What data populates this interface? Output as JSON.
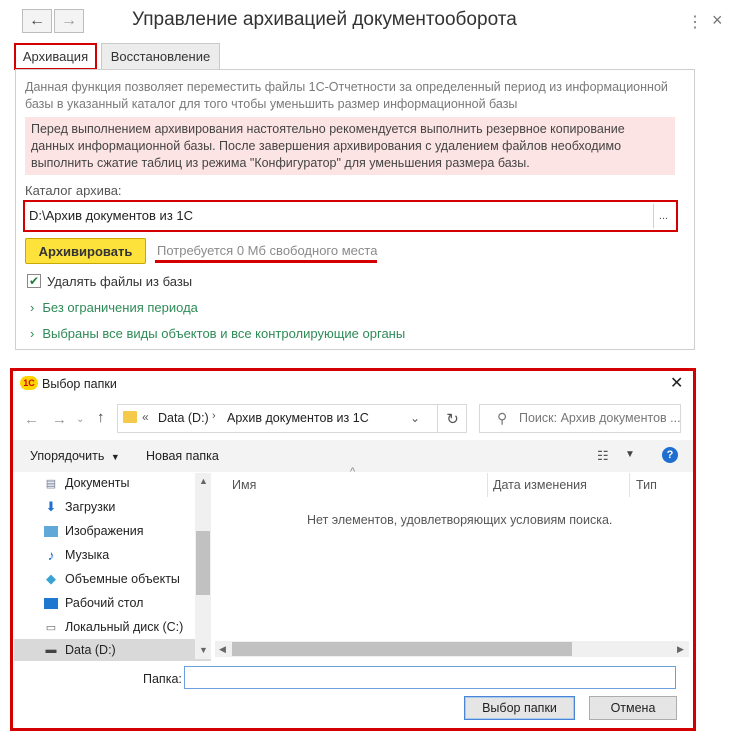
{
  "window": {
    "title": "Управление архивацией документооборота",
    "back_icon": "←",
    "forward_icon": "→",
    "menu_icon": "⋮",
    "close_icon": "×"
  },
  "tabs": [
    "Архивация",
    "Восстановление"
  ],
  "archive": {
    "intro": "Данная функция позволяет переместить файлы 1С-Отчетности за определенный период из информационной базы в указанный каталог для того чтобы уменьшить размер информационной базы",
    "warning": "Перед выполнением архивирования настоятельно рекомендуется выполнить резервное копирование данных информационной базы. После завершения архивирования с удалением файлов необходимо выполнить сжатие таблиц из режима \"Конфигуратор\" для уменьшения размера базы.",
    "catalog_label": "Каталог архива:",
    "catalog_value": "D:\\Архив документов из 1С",
    "catalog_button": "...",
    "archive_button": "Архивировать",
    "space_text": "Потребуется 0 Мб свободного места",
    "delete_checkbox_label": "Удалять файлы из базы",
    "delete_checked": true,
    "period_link": "Без ограничения периода",
    "objects_link": "Выбраны все виды объектов и все контролирующие органы"
  },
  "dialog": {
    "logo": "1С",
    "title": "Выбор папки",
    "path": [
      "Data (D:)",
      "Архив документов из 1С"
    ],
    "path_prefix": "«",
    "search_placeholder": "Поиск: Архив документов ...",
    "toolbar": {
      "organize": "Упорядочить",
      "new_folder": "Новая папка"
    },
    "tree": [
      {
        "label": "Документы",
        "icon": "documents-icon"
      },
      {
        "label": "Загрузки",
        "icon": "downloads-icon"
      },
      {
        "label": "Изображения",
        "icon": "pictures-icon"
      },
      {
        "label": "Музыка",
        "icon": "music-icon"
      },
      {
        "label": "Объемные объекты",
        "icon": "3d-objects-icon"
      },
      {
        "label": "Рабочий стол",
        "icon": "desktop-icon"
      },
      {
        "label": "Локальный диск (C:)",
        "icon": "drive-icon"
      },
      {
        "label": "Data (D:)",
        "icon": "drive-icon"
      }
    ],
    "selected_tree_item": "Data (D:)",
    "columns": [
      "Имя",
      "Дата изменения",
      "Тип"
    ],
    "empty_message": "Нет элементов, удовлетворяющих условиям поиска.",
    "folder_label": "Папка:",
    "folder_value": "",
    "select_button": "Выбор папки",
    "cancel_button": "Отмена"
  },
  "colors": {
    "accent_red": "#d40000",
    "yellow_button": "#fce23a",
    "link_green": "#2e8b57"
  }
}
